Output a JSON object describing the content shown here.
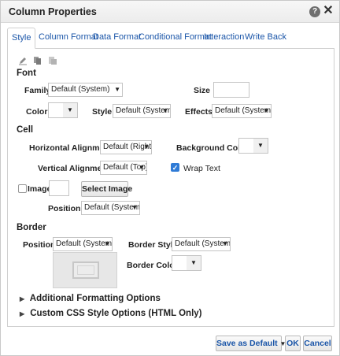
{
  "dialog": {
    "title": "Column Properties",
    "help_glyph": "?",
    "close_glyph": "✕"
  },
  "tabs": [
    {
      "label": "Style",
      "active": true
    },
    {
      "label": "Column Format",
      "active": false
    },
    {
      "label": "Data Format",
      "active": false
    },
    {
      "label": "Conditional Format",
      "active": false
    },
    {
      "label": "Interaction",
      "active": false
    },
    {
      "label": "Write Back",
      "active": false
    }
  ],
  "toolbar": {
    "icons": [
      "pencil-icon",
      "copy-icon",
      "paste-icon"
    ]
  },
  "font": {
    "heading": "Font",
    "family_label": "Family",
    "family_value": "Default (System)",
    "size_label": "Size",
    "size_value": "",
    "color_label": "Color",
    "style_label": "Style",
    "style_value": "Default (System)",
    "effects_label": "Effects",
    "effects_value": "Default (System)"
  },
  "cell": {
    "heading": "Cell",
    "halign_label": "Horizontal Alignment",
    "halign_value": "Default (Right)",
    "bg_color_label": "Background Color",
    "valign_label": "Vertical Alignment",
    "valign_value": "Default (Top)",
    "wrap_text_label": "Wrap Text",
    "wrap_text_checked": true,
    "image_label": "Image",
    "image_checked": false,
    "select_image_label": "Select Image",
    "position_label": "Position",
    "position_value": "Default (System)"
  },
  "border": {
    "heading": "Border",
    "position_label": "Position",
    "position_value": "Default (System)",
    "style_label": "Border Style",
    "style_value": "Default (System)",
    "color_label": "Border Color"
  },
  "expanders": [
    {
      "label": "Additional Formatting Options"
    },
    {
      "label": "Custom CSS Style Options (HTML Only)"
    }
  ],
  "footer": {
    "save_default_label": "Save as Default",
    "ok_label": "OK",
    "cancel_label": "Cancel"
  },
  "glyphs": {
    "caret_down": "▼",
    "expander_right": "▶",
    "check": "✓"
  },
  "colors": {
    "accent_link": "#1a55a8",
    "checkbox_checked": "#2f7bd6"
  }
}
